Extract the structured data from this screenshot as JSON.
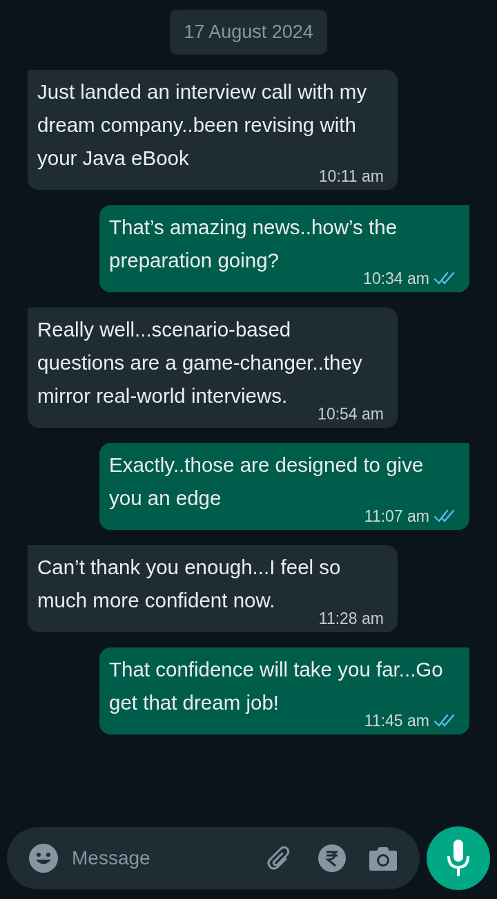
{
  "date_chip": "17 August 2024",
  "messages": [
    {
      "kind": "incoming",
      "text": "Just landed an interview call with my dream company..been revising with your Java eBook",
      "time": "10:11 am"
    },
    {
      "kind": "outgoing",
      "text": "That’s amazing news..how’s the preparation going?",
      "time": "10:34 am",
      "read": true
    },
    {
      "kind": "incoming",
      "text": "Really well...scenario-based questions are a game-changer..they mirror real-world interviews.",
      "time": "10:54 am"
    },
    {
      "kind": "outgoing",
      "text": "Exactly..those are designed to give you an edge",
      "time": "11:07 am",
      "read": true
    },
    {
      "kind": "incoming",
      "text": "Can’t thank you enough...I feel so much more confident now.",
      "time": "11:28 am"
    },
    {
      "kind": "outgoing",
      "text": "That confidence will take you far...Go get that dream job!",
      "time": "11:45 am",
      "read": true
    }
  ],
  "composer": {
    "placeholder": "Message"
  }
}
